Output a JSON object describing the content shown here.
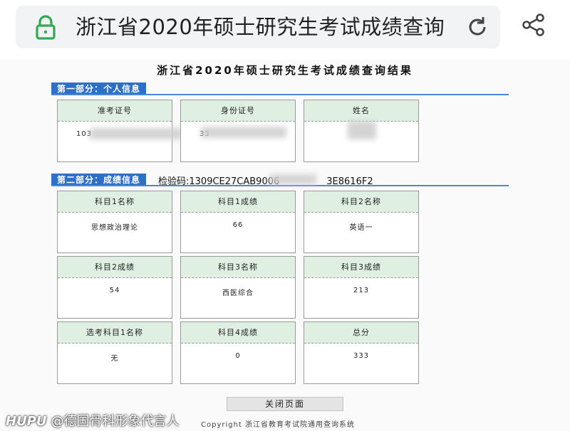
{
  "browser": {
    "title": "浙江省2020年硕士研究生考试成绩查询",
    "lock_icon": "lock-icon",
    "reload_icon": "reload-icon",
    "share_icon": "share-icon",
    "accent_color": "#34a853"
  },
  "page": {
    "result_title": "浙江省2020年硕士研究生考试成绩查询结果",
    "section1": {
      "label": "第一部分：个人信息",
      "cards": [
        {
          "label": "准考证号",
          "value": "103"
        },
        {
          "label": "身份证号",
          "value": "33"
        },
        {
          "label": "姓名",
          "value": ""
        }
      ]
    },
    "section2": {
      "label": "第二部分：成绩信息",
      "check_code": "检验码:1309CE27CAB9006",
      "check_code_tail": "3E8616F2",
      "cards": [
        {
          "label": "科目1名称",
          "value": "思想政治理论"
        },
        {
          "label": "科目1成绩",
          "value": "66"
        },
        {
          "label": "科目2名称",
          "value": "英语一"
        },
        {
          "label": "科目2成绩",
          "value": "54"
        },
        {
          "label": "科目3名称",
          "value": "西医综合"
        },
        {
          "label": "科目3成绩",
          "value": "213"
        },
        {
          "label": "选考科目1名称",
          "value": "无"
        },
        {
          "label": "科目4成绩",
          "value": "0"
        },
        {
          "label": "总分",
          "value": "333"
        }
      ]
    },
    "close_button": "关闭页面",
    "copyright": "Copyright 浙江省教育考试院通用查询系统",
    "watermark": {
      "brand": "HUPU",
      "user": "@德国骨科形象代言人"
    },
    "section_color": "#2e6fc8",
    "card_head_color": "#dff0e3"
  }
}
